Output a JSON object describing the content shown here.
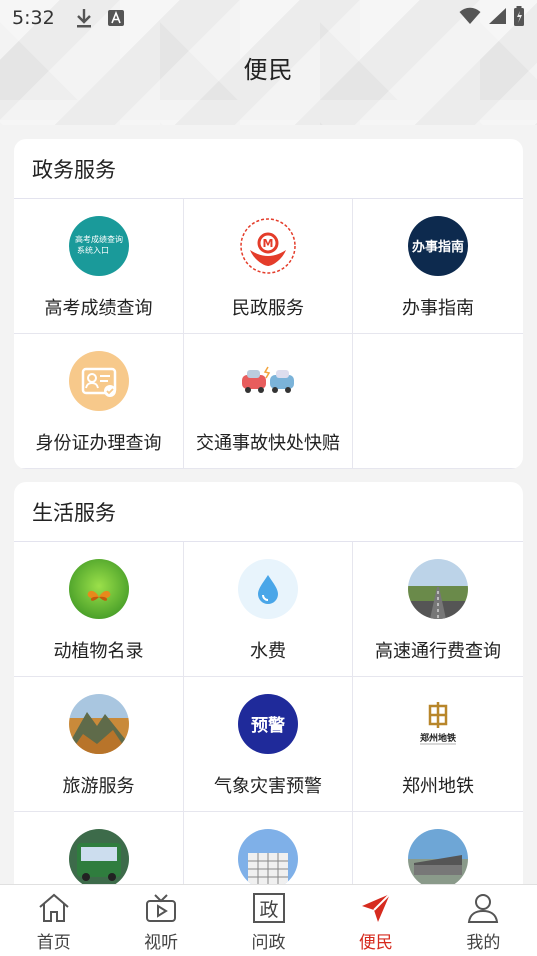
{
  "status": {
    "time": "5:32"
  },
  "page_title": "便民",
  "gov_section": {
    "title": "政务服务",
    "items": [
      {
        "label": "高考成绩查询",
        "icon": "gaokao-icon",
        "icon_text": "高考成绩查询系统入口"
      },
      {
        "label": "民政服务",
        "icon": "civil-affairs-icon"
      },
      {
        "label": "办事指南",
        "icon": "guide-icon",
        "icon_text": "办事指南"
      },
      {
        "label": "身份证办理查询",
        "icon": "id-card-icon"
      },
      {
        "label": "交通事故快处快赔",
        "icon": "car-accident-icon"
      }
    ]
  },
  "life_section": {
    "title": "生活服务",
    "items": [
      {
        "label": "动植物名录",
        "icon": "butterfly-icon"
      },
      {
        "label": "水费",
        "icon": "water-drop-icon"
      },
      {
        "label": "高速通行费查询",
        "icon": "highway-icon"
      },
      {
        "label": "旅游服务",
        "icon": "mountain-icon"
      },
      {
        "label": "气象灾害预警",
        "icon": "weather-warning-icon",
        "icon_text": "预警"
      },
      {
        "label": "郑州地铁",
        "icon": "metro-logo-icon",
        "icon_text": "郑州地铁"
      },
      {
        "label": "",
        "icon": "bus-icon"
      },
      {
        "label": "",
        "icon": "building-icon"
      },
      {
        "label": "",
        "icon": "station-icon"
      }
    ]
  },
  "tabs": [
    {
      "label": "首页",
      "icon": "home-icon"
    },
    {
      "label": "视听",
      "icon": "tv-icon"
    },
    {
      "label": "问政",
      "icon": "politics-icon",
      "icon_text": "政"
    },
    {
      "label": "便民",
      "icon": "send-icon",
      "active": true
    },
    {
      "label": "我的",
      "icon": "user-icon"
    }
  ],
  "colors": {
    "accent": "#d62b1f",
    "guide_bg": "#0d2a4e",
    "gaokao_bg": "#1a9a9a",
    "warning_bg": "#1f2a9a"
  }
}
